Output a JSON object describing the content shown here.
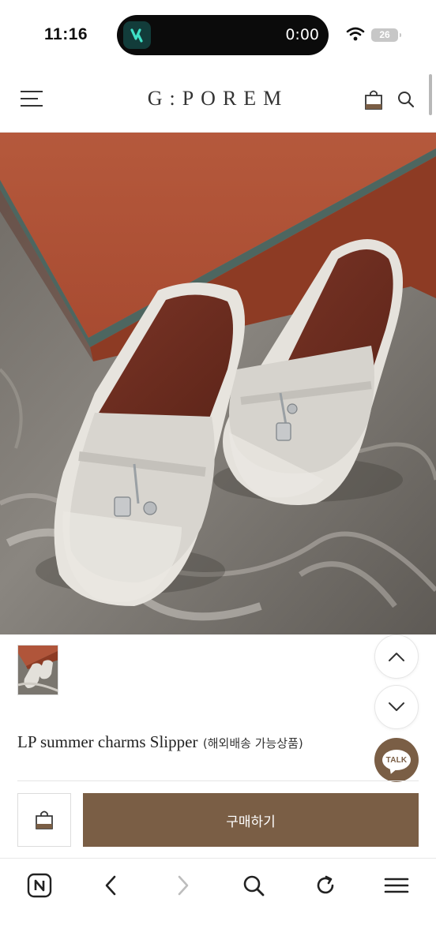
{
  "status_bar": {
    "time": "11:16",
    "timer": "0:00",
    "battery": "26"
  },
  "header": {
    "logo": "G:POREM"
  },
  "product": {
    "title": "LP summer charms Slipper",
    "shipping_note": "(해외배송 가능상품)",
    "buy_label": "구매하기"
  },
  "talk_button": {
    "label": "TALK"
  },
  "icons": {
    "menu": "hamburger-menu-icon",
    "cart": "shopping-bag-icon",
    "search": "search-icon",
    "scroll_up": "chevron-up-icon",
    "scroll_down": "chevron-down-icon",
    "bag": "shopping-bag-icon",
    "browser_home": "naver-n-icon",
    "back": "chevron-left-icon",
    "forward": "chevron-right-icon",
    "browser_search": "search-icon",
    "reload": "reload-icon",
    "browser_menu": "hamburger-menu-icon"
  },
  "colors": {
    "brand_brown": "#7a5e45",
    "text": "#222222"
  }
}
